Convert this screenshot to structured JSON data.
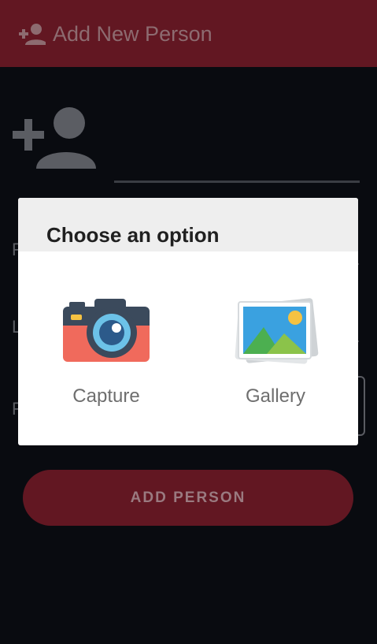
{
  "appbar": {
    "title": "Add New Person",
    "icon": "person-add-icon",
    "background": "#621722"
  },
  "form": {
    "avatar_icon": "person-add-icon",
    "hidden_field_initials": [
      "F",
      "L",
      "F"
    ],
    "submit_label": "ADD PERSON"
  },
  "dialog": {
    "title": "Choose an option",
    "options": [
      {
        "label": "Capture",
        "icon": "camera-icon"
      },
      {
        "label": "Gallery",
        "icon": "gallery-icon"
      }
    ]
  },
  "colors": {
    "background": "#090b10",
    "accent": "#621722",
    "dialog_header": "#eeeeee"
  }
}
